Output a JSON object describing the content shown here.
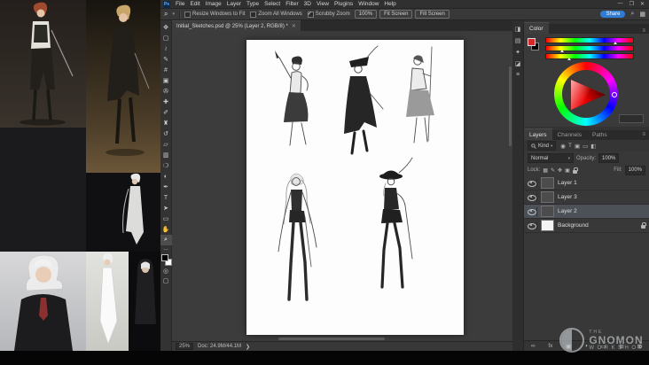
{
  "menubar": {
    "logo": "Ps",
    "items": [
      "File",
      "Edit",
      "Image",
      "Layer",
      "Type",
      "Select",
      "Filter",
      "3D",
      "View",
      "Plugins",
      "Window",
      "Help"
    ],
    "window_controls": [
      "—",
      "❐",
      "✕"
    ]
  },
  "options_bar": {
    "tool_glyph": "⌕",
    "caret": "▾",
    "checkboxes": [
      {
        "label": "Resize Windows to Fit",
        "checked": false
      },
      {
        "label": "Zoom All Windows",
        "checked": false
      },
      {
        "label": "Scrubby Zoom",
        "checked": true
      }
    ],
    "buttons": [
      "100%",
      "Fit Screen",
      "Fill Screen"
    ],
    "share_label": "Share",
    "right_icons": [
      "⌕",
      "▦"
    ]
  },
  "doc_tab": {
    "title": "Initial_Sketches.psd @ 25% (Layer 2, RGB/8) *",
    "close": "✕"
  },
  "tools": [
    {
      "name": "move",
      "glyph": "✥"
    },
    {
      "name": "marquee",
      "glyph": "▢"
    },
    {
      "name": "lasso",
      "glyph": "≀"
    },
    {
      "name": "quick-selection",
      "glyph": "✎"
    },
    {
      "name": "crop",
      "glyph": "#"
    },
    {
      "name": "frame",
      "glyph": "▣"
    },
    {
      "name": "eyedropper",
      "glyph": "✇"
    },
    {
      "name": "healing-brush",
      "glyph": "✚"
    },
    {
      "name": "brush",
      "glyph": "✐"
    },
    {
      "name": "clone-stamp",
      "glyph": "♜"
    },
    {
      "name": "history-brush",
      "glyph": "↺"
    },
    {
      "name": "eraser",
      "glyph": "▱"
    },
    {
      "name": "gradient",
      "glyph": "▥"
    },
    {
      "name": "blur",
      "glyph": "❍"
    },
    {
      "name": "dodge",
      "glyph": "◐"
    },
    {
      "name": "pen",
      "glyph": "✒"
    },
    {
      "name": "type",
      "glyph": "T"
    },
    {
      "name": "path-selection",
      "glyph": "➤"
    },
    {
      "name": "shape",
      "glyph": "▭"
    },
    {
      "name": "hand",
      "glyph": "✋"
    },
    {
      "name": "zoom",
      "glyph": "⌕",
      "active": true
    }
  ],
  "tools_extra": {
    "ellipsis": "…",
    "quick_mask": "◎",
    "screen_mode": "▢"
  },
  "collapsed_strip": {
    "icons": [
      "◨",
      "▤",
      "✦",
      "◪",
      "≡"
    ]
  },
  "color_panel": {
    "title": "Color"
  },
  "layers_panel": {
    "tabs": [
      {
        "label": "Layers",
        "active": true
      },
      {
        "label": "Channels"
      },
      {
        "label": "Paths"
      }
    ],
    "panel_menu": "≡",
    "kind_label": "Kind",
    "kind_caret": "▾",
    "filter_icons": [
      "◉",
      "T",
      "▣",
      "▭",
      "◧"
    ],
    "blend_mode": "Normal",
    "blend_caret": "▾",
    "opacity_label": "Opacity:",
    "opacity_value": "100%",
    "lock_label": "Lock:",
    "lock_icons": [
      "▦",
      "✎",
      "✥",
      "▣"
    ],
    "fill_label": "Fill:",
    "fill_value": "100%",
    "layers": [
      {
        "name": "Layer 1"
      },
      {
        "name": "Layer 3"
      },
      {
        "name": "Layer 2",
        "selected": true
      },
      {
        "name": "Background",
        "locked": true,
        "white": true
      }
    ],
    "footer_icons": [
      "∞",
      "fx",
      "▣",
      "◑",
      "▭",
      "⊞",
      "⊠"
    ]
  },
  "status_bar": {
    "zoom": "25%",
    "doc_info": "Doc: 24.9M/44.1M",
    "chevron": "❯"
  },
  "watermark": {
    "the": "THE",
    "name": "GNOMON",
    "word": "WORKSHOP"
  },
  "colors": {
    "accent_blue": "#2e7cd6",
    "canvas_gray": "#3c3c3c",
    "selection_gray": "#4c5158"
  }
}
